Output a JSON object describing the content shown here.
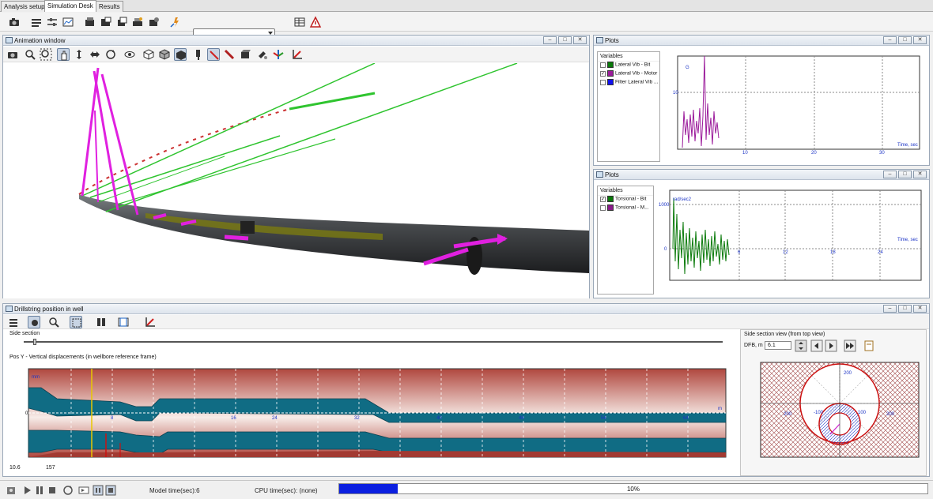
{
  "tabs": [
    {
      "label": "Analysis setup",
      "active": false
    },
    {
      "label": "Simulation Desk",
      "active": true
    },
    {
      "label": "Results",
      "active": false
    }
  ],
  "toolbar": {
    "combo_value": ""
  },
  "animation": {
    "title": "Animation window",
    "colors": {
      "pipe": "#3a3d40",
      "trajectory": "#cc3333",
      "force_green": "#2fc42f",
      "force_magenta": "#e020e0",
      "yellow": "#7a7a10"
    }
  },
  "plot1": {
    "title": "Plots",
    "variables_label": "Variables",
    "variables": [
      {
        "label": "Lateral Vib - Bit",
        "checked": false,
        "color": "#0a7a0a"
      },
      {
        "label": "Lateral Vib - Motor",
        "checked": true,
        "color": "#9b1b9b"
      },
      {
        "label": "Filter Lateral Vib ...",
        "checked": false,
        "color": "#1010ee"
      }
    ],
    "unit": "G",
    "ytick": "10",
    "xticks": [
      "10",
      "20",
      "30"
    ],
    "xlabel": "Time, sec"
  },
  "plot2": {
    "title": "Plots",
    "variables_label": "Variables",
    "variables": [
      {
        "label": "Torsional - Bit",
        "checked": true,
        "color": "#0a7a0a"
      },
      {
        "label": "Torsional - M...",
        "checked": false,
        "color": "#8a1a8a"
      }
    ],
    "unit": "rad/sec2",
    "yticks": [
      "1000",
      "0"
    ],
    "xticks": [
      "6",
      "12",
      "18",
      "24"
    ],
    "xlabel": "Time, sec"
  },
  "drillstring": {
    "title": "Drillstring position in well",
    "side_section_label": "Side section",
    "chart_title": "Pos Y - Vertical displacements (in wellbore reference frame)",
    "unit_y": "mm",
    "unit_x": "m",
    "xticks": [
      "8",
      "16",
      "24",
      "32",
      "40",
      "48",
      "56",
      "64"
    ],
    "ylabel0": "0",
    "status_left": "10.6",
    "status_right": "157",
    "colors": {
      "wall": "#b0473e",
      "string": "#106c84",
      "cursor": "#e8c800",
      "marker": "#cc1111"
    }
  },
  "sidesection": {
    "title": "Side section view (from top view)",
    "dfb_label": "DFB, m",
    "dfb_value": "6.1",
    "labels": {
      "top": "200",
      "left": "200",
      "right": "200",
      "mid_left": "-100",
      "mid_right": "100"
    }
  },
  "status": {
    "model_time": "Model time(sec):6",
    "cpu_time": "CPU time(sec): (none)",
    "progress_label": "10%",
    "progress": 0.1
  }
}
